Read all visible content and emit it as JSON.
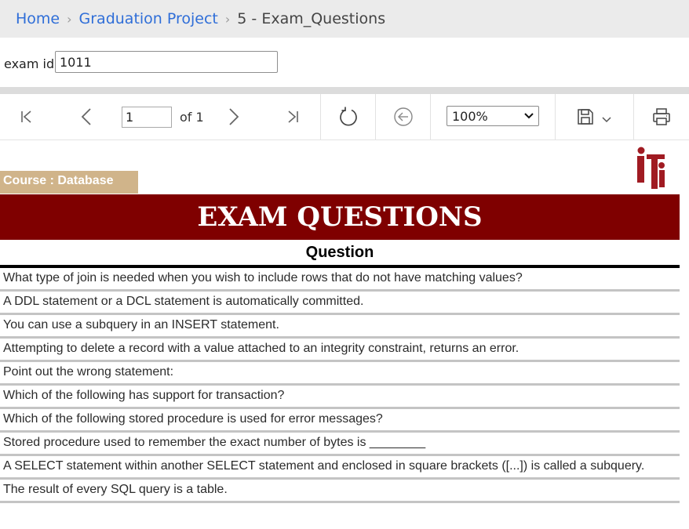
{
  "breadcrumb": {
    "items": [
      {
        "label": "Home"
      },
      {
        "label": "Graduation Project"
      },
      {
        "label": "5 - Exam_Questions"
      }
    ],
    "separator": "›"
  },
  "parameters": {
    "exam_id_label": "exam id",
    "exam_id_value": "1011"
  },
  "toolbar": {
    "current_page": "1",
    "of_label": "of 1",
    "zoom": "100%"
  },
  "report": {
    "course_label": "Course : Database",
    "banner_title": "EXAM QUESTIONS",
    "column_header": "Question",
    "questions": [
      "What type of join is needed when you wish to include rows that do not have matching values?",
      "A DDL statement or a DCL statement is automatically committed.",
      "You can use a subquery in an INSERT statement.",
      "Attempting to delete a record with a value attached to an integrity constraint, returns an error.",
      "Point out the wrong statement:",
      "Which of the following has support for transaction?",
      "Which of the following stored procedure is used for error messages?",
      "Stored procedure used to remember the exact number of bytes is ________",
      "A SELECT statement within another SELECT statement and enclosed in square brackets ([...]) is called a subquery.",
      "The result of every SQL query is a table."
    ]
  },
  "colors": {
    "breadcrumb_link": "#2f6ed8",
    "banner_bg": "#7f0000",
    "course_bg": "#d0b48a",
    "logo_red": "#a01b22"
  }
}
